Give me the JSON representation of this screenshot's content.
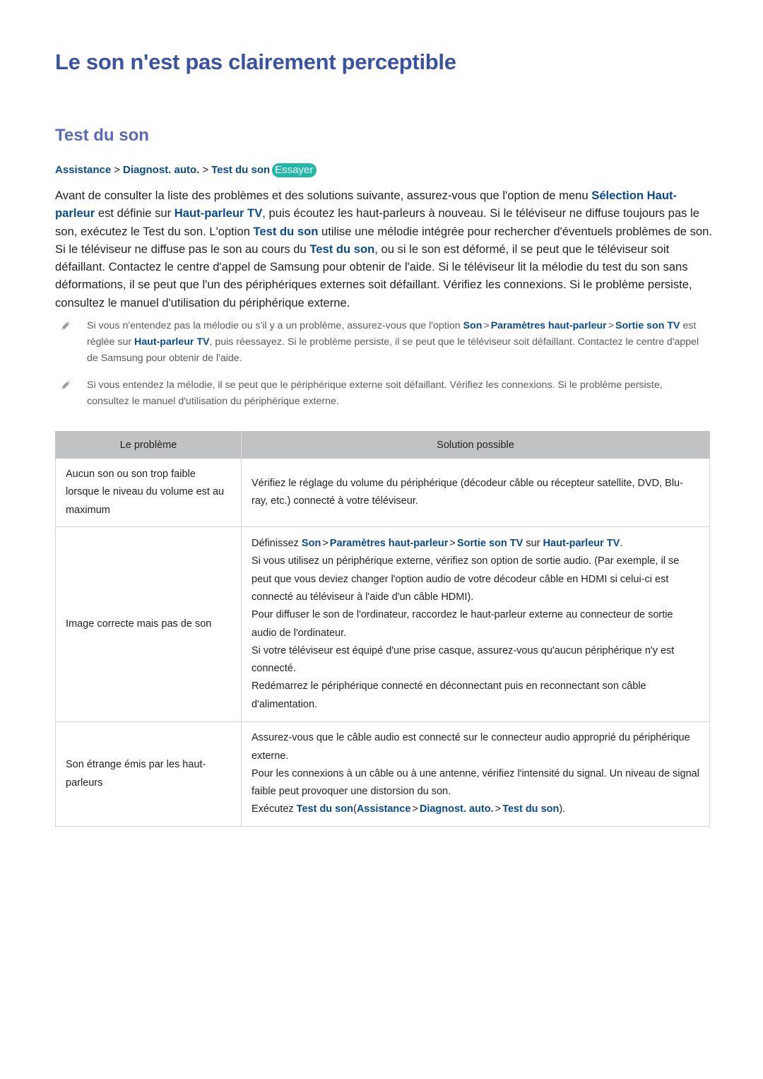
{
  "page": {
    "title": "Le son n'est pas clairement perceptible",
    "section_title": "Test du son",
    "menu_path": {
      "items": [
        "Assistance",
        "Diagnost. auto.",
        "Test du son"
      ],
      "separator": ">",
      "try_badge": "Essayer"
    },
    "intro": {
      "t1": "Avant de consulter la liste des problèmes et des solutions suivante, assurez-vous que l'option de menu ",
      "h1": "Sélection Haut-parleur",
      "t2": " est définie sur ",
      "h2": "Haut-parleur TV",
      "t3": ", puis écoutez les haut-parleurs à nouveau. Si le téléviseur ne diffuse toujours pas le son, exécutez le Test du son. L'option ",
      "h3": "Test du son",
      "t4": " utilise une mélodie intégrée pour rechercher d'éventuels problèmes de son. Si le téléviseur ne diffuse pas le son au cours du ",
      "h4": "Test du son",
      "t5": ", ou si le son est déformé, il se peut que le téléviseur soit défaillant. Contactez le centre d'appel de Samsung pour obtenir de l'aide. Si le téléviseur lit la mélodie du test du son sans déformations, il se peut que l'un des périphériques externes soit défaillant. Vérifiez les connexions. Si le problème persiste, consultez le manuel d'utilisation du périphérique externe."
    },
    "notes": [
      {
        "icon": "pencil-icon",
        "t1": "Si vous n'entendez pas la mélodie ou s'il y a un problème, assurez-vous que l'option ",
        "h1": "Son",
        "sep1": ">",
        "h2": "Paramètres haut-parleur",
        "sep2": ">",
        "h3": "Sortie son TV",
        "t2": " est réglée sur ",
        "h4": "Haut-parleur TV",
        "t3": ", puis réessayez. Si le problème persiste, il se peut que le téléviseur soit défaillant. Contactez le centre d'appel de Samsung pour obtenir de l'aide."
      },
      {
        "icon": "pencil-icon",
        "text": "Si vous entendez la mélodie, il se peut que le périphérique externe soit défaillant. Vérifiez les connexions. Si le problème persiste, consultez le manuel d'utilisation du périphérique externe."
      }
    ],
    "table": {
      "headers": [
        "Le problème",
        "Solution possible"
      ],
      "rows": [
        {
          "problem": "Aucun son ou son trop faible lorsque le niveau du volume est au maximum",
          "solution_lines": [
            "Vérifiez le réglage du volume du périphérique (décodeur câble ou récepteur satellite, DVD, Blu-ray, etc.) connecté à votre téléviseur."
          ]
        },
        {
          "problem": "Image correcte mais pas de son",
          "first_line": {
            "t1": "Définissez ",
            "h1": "Son",
            "h2": "Paramètres haut-parleur",
            "h3": "Sortie son TV",
            "t2": " sur ",
            "h4": "Haut-parleur TV",
            "t3": "."
          },
          "solution_lines": [
            "Si vous utilisez un périphérique externe, vérifiez son option de sortie audio. (Par exemple, il se peut que vous deviez changer l'option audio de votre décodeur câble en HDMI si celui-ci est connecté au téléviseur à l'aide d'un câble HDMI).",
            "Pour diffuser le son de l'ordinateur, raccordez le haut-parleur externe au connecteur de sortie audio de l'ordinateur.",
            "Si votre téléviseur est équipé d'une prise casque, assurez-vous qu'aucun périphérique n'y est connecté.",
            "Redémarrez le périphérique connecté en déconnectant puis en reconnectant son câble d'alimentation."
          ]
        },
        {
          "problem": "Son étrange émis par les haut-parleurs",
          "solution_lines": [
            "Assurez-vous que le câble audio est connecté sur le connecteur audio approprié du périphérique externe.",
            "Pour les connexions à un câble ou à une antenne, vérifiez l'intensité du signal. Un niveau de signal faible peut provoquer une distorsion du son."
          ],
          "last_line": {
            "t1": "Exécutez ",
            "h1": "Test du son",
            "t2": "(",
            "h2": "Assistance",
            "h3": "Diagnost. auto.",
            "h4": "Test du son",
            "t3": ")."
          }
        }
      ]
    },
    "separator": ">",
    "colors": {
      "title": "#3a52a0",
      "section_title": "#5b69b6",
      "highlight": "#0a4a8f",
      "badge": "#22b8a8",
      "table_header": "#c1c2c4"
    }
  }
}
